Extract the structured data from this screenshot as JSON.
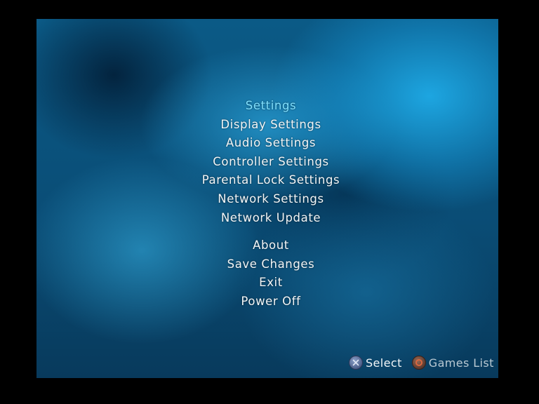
{
  "menu": {
    "title": "Settings",
    "items": [
      "Display Settings",
      "Audio Settings",
      "Controller Settings",
      "Parental Lock Settings",
      "Network Settings",
      "Network Update"
    ],
    "secondary_items": [
      "About",
      "Save Changes",
      "Exit",
      "Power Off"
    ]
  },
  "hints": {
    "select_label": "Select",
    "select_icon": "cross-button-icon",
    "games_list_label": "Games List",
    "games_list_icon": "circle-button-icon"
  },
  "colors": {
    "title": "#7fe0ff",
    "menu_text": "#f2f6f8",
    "background_blue": "#0b5a86"
  }
}
